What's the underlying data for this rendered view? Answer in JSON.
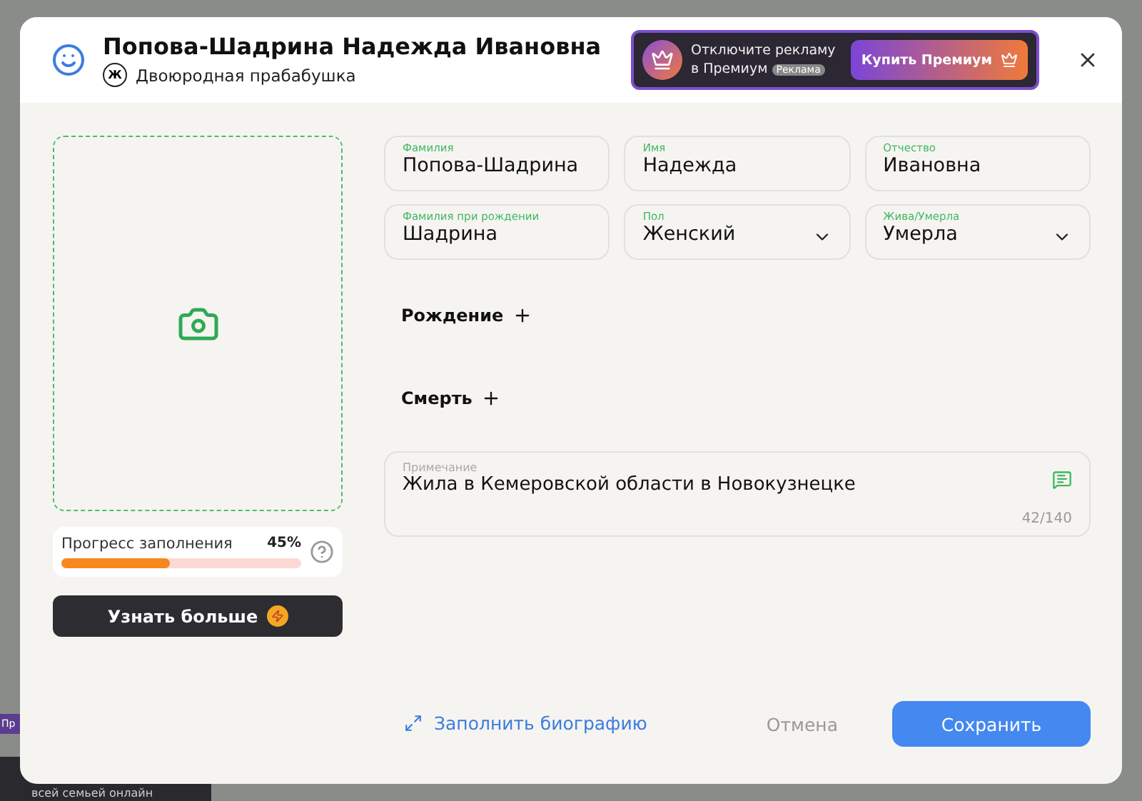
{
  "background": {
    "tag": "Пр",
    "caption": "всей семьей онлайн"
  },
  "header": {
    "name": "Попова-Шадрина Надежда Ивановна",
    "gender_mark": "Ж",
    "relation": "Двоюродная прабабушка"
  },
  "promo": {
    "text": "Отключите рекламу в Премиум",
    "badge": "Реклама",
    "button": "Купить Премиум"
  },
  "fields": [
    {
      "label": "Фамилия",
      "value": "Попова-Шадрина",
      "kind": "text"
    },
    {
      "label": "Имя",
      "value": "Надежда",
      "kind": "text"
    },
    {
      "label": "Отчество",
      "value": "Ивановна",
      "kind": "text"
    },
    {
      "label": "Фамилия при рождении",
      "value": "Шадрина",
      "kind": "text"
    },
    {
      "label": "Пол",
      "value": "Женский",
      "kind": "select"
    },
    {
      "label": "Жива/Умерла",
      "value": "Умерла",
      "kind": "select"
    }
  ],
  "sections": [
    {
      "label": "Рождение",
      "expanded": false
    },
    {
      "label": "Смерть",
      "expanded": false
    }
  ],
  "note": {
    "label": "Примечание",
    "value": "Жила в Кемеровской области в Новокузнецке",
    "counter": "42/140"
  },
  "progress": {
    "label": "Прогресс заполнения",
    "reading": "45%",
    "level": 0.45
  },
  "learn_more": "Узнать больше",
  "footer": {
    "link": "Заполнить биографию",
    "cancel": "Отмена",
    "save": "Сохранить"
  }
}
